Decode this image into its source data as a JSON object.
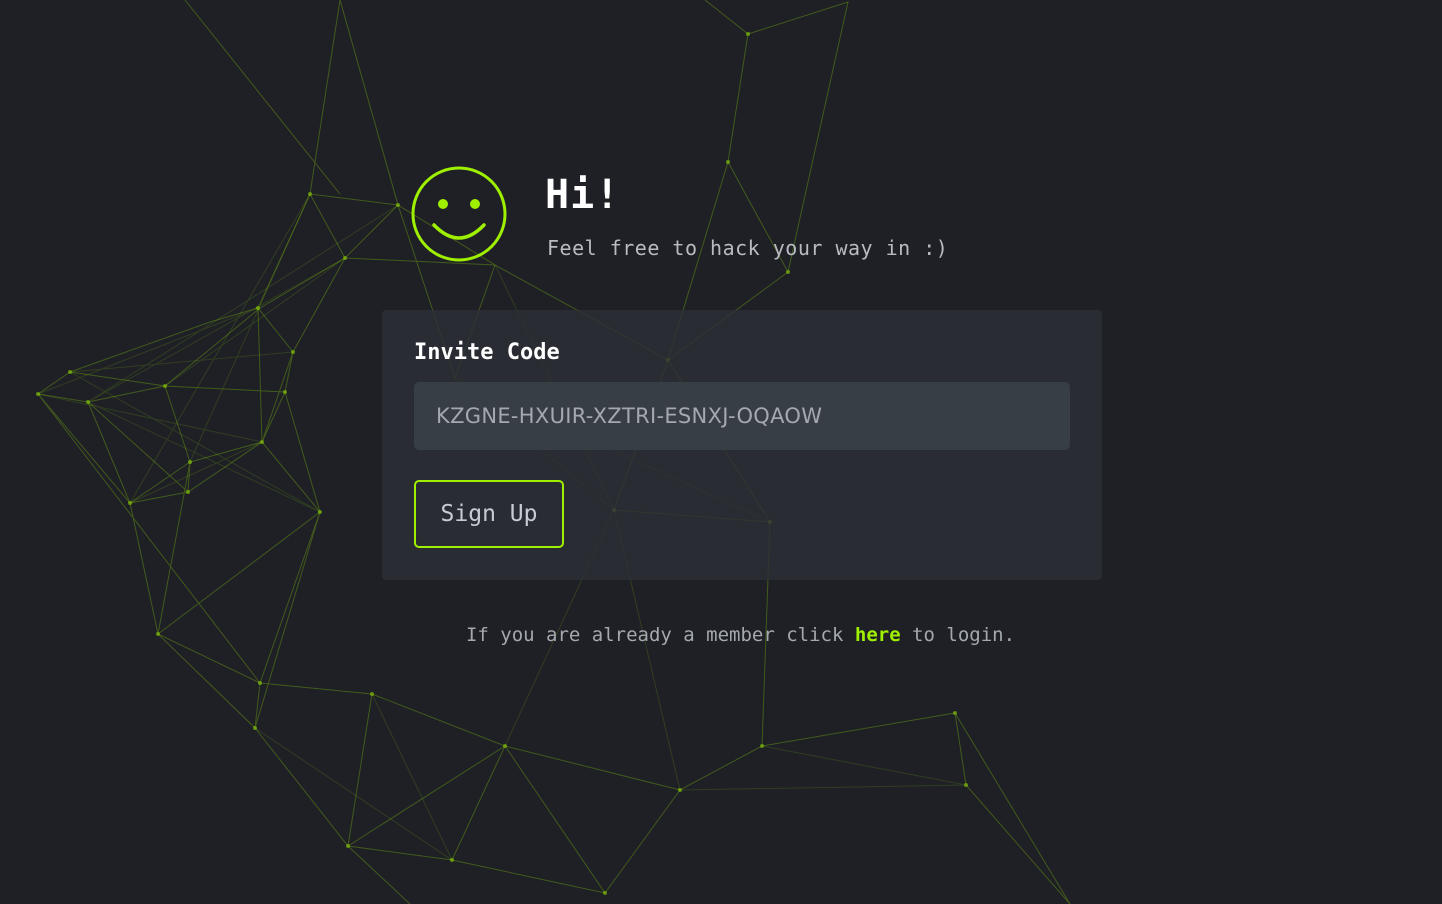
{
  "colors": {
    "background": "#1e2026",
    "accent": "#9fef00",
    "card": "#2c3036",
    "input": "#383e46"
  },
  "header": {
    "icon": "smiley-face-icon",
    "title": "Hi!",
    "subtitle": "Feel free to hack your way in :)"
  },
  "form": {
    "label": "Invite Code",
    "invite_code_value": "KZGNE-HXUIR-XZTRI-ESNXJ-OQAOW",
    "submit_label": "Sign Up"
  },
  "footer": {
    "prefix": "If you are already a member click ",
    "link_text": "here",
    "suffix": " to login."
  }
}
